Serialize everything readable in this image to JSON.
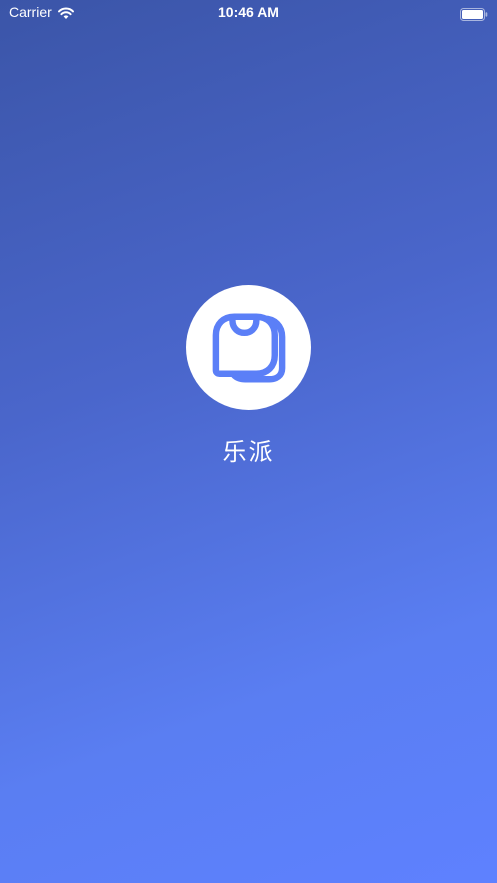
{
  "status_bar": {
    "carrier": "Carrier",
    "time": "10:46 AM",
    "wifi_icon": "wifi-icon",
    "battery_icon": "battery-icon"
  },
  "splash": {
    "logo_icon": "chat-bubble-logo-icon",
    "app_name": "乐派"
  },
  "colors": {
    "background_top": "#3b55a8",
    "background_bottom": "#5e81ff",
    "logo_stroke": "#5b7ff7",
    "logo_background": "#ffffff"
  }
}
